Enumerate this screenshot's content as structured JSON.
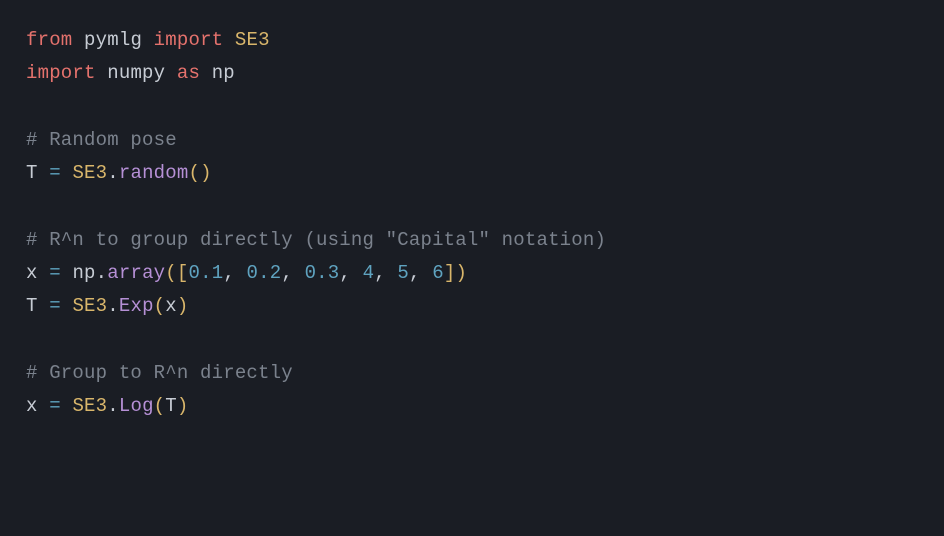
{
  "code": {
    "import1": {
      "kw_from": "from",
      "module": "pymlg",
      "kw_import": "import",
      "cls": "SE3"
    },
    "import2": {
      "kw_import": "import",
      "module": "numpy",
      "kw_as": "as",
      "alias": "np"
    },
    "comment1": "# Random pose",
    "line_T_random": {
      "lhs": "T",
      "eq": "=",
      "cls": "SE3",
      "method": "random",
      "lp": "(",
      "rp": ")"
    },
    "comment2": "# R^n to group directly (using \"Capital\" notation)",
    "line_x_array": {
      "lhs": "x",
      "eq": "=",
      "obj": "np",
      "method": "array",
      "lp": "(",
      "lb": "[",
      "n0": "0.1",
      "n1": "0.2",
      "n2": "0.3",
      "n3": "4",
      "n4": "5",
      "n5": "6",
      "rb": "]",
      "rp": ")",
      "comma": ","
    },
    "line_T_Exp": {
      "lhs": "T",
      "eq": "=",
      "cls": "SE3",
      "method": "Exp",
      "arg": "x",
      "lp": "(",
      "rp": ")"
    },
    "comment3": "# Group to R^n directly",
    "line_x_Log": {
      "lhs": "x",
      "eq": "=",
      "cls": "SE3",
      "method": "Log",
      "arg": "T",
      "lp": "(",
      "rp": ")"
    }
  }
}
